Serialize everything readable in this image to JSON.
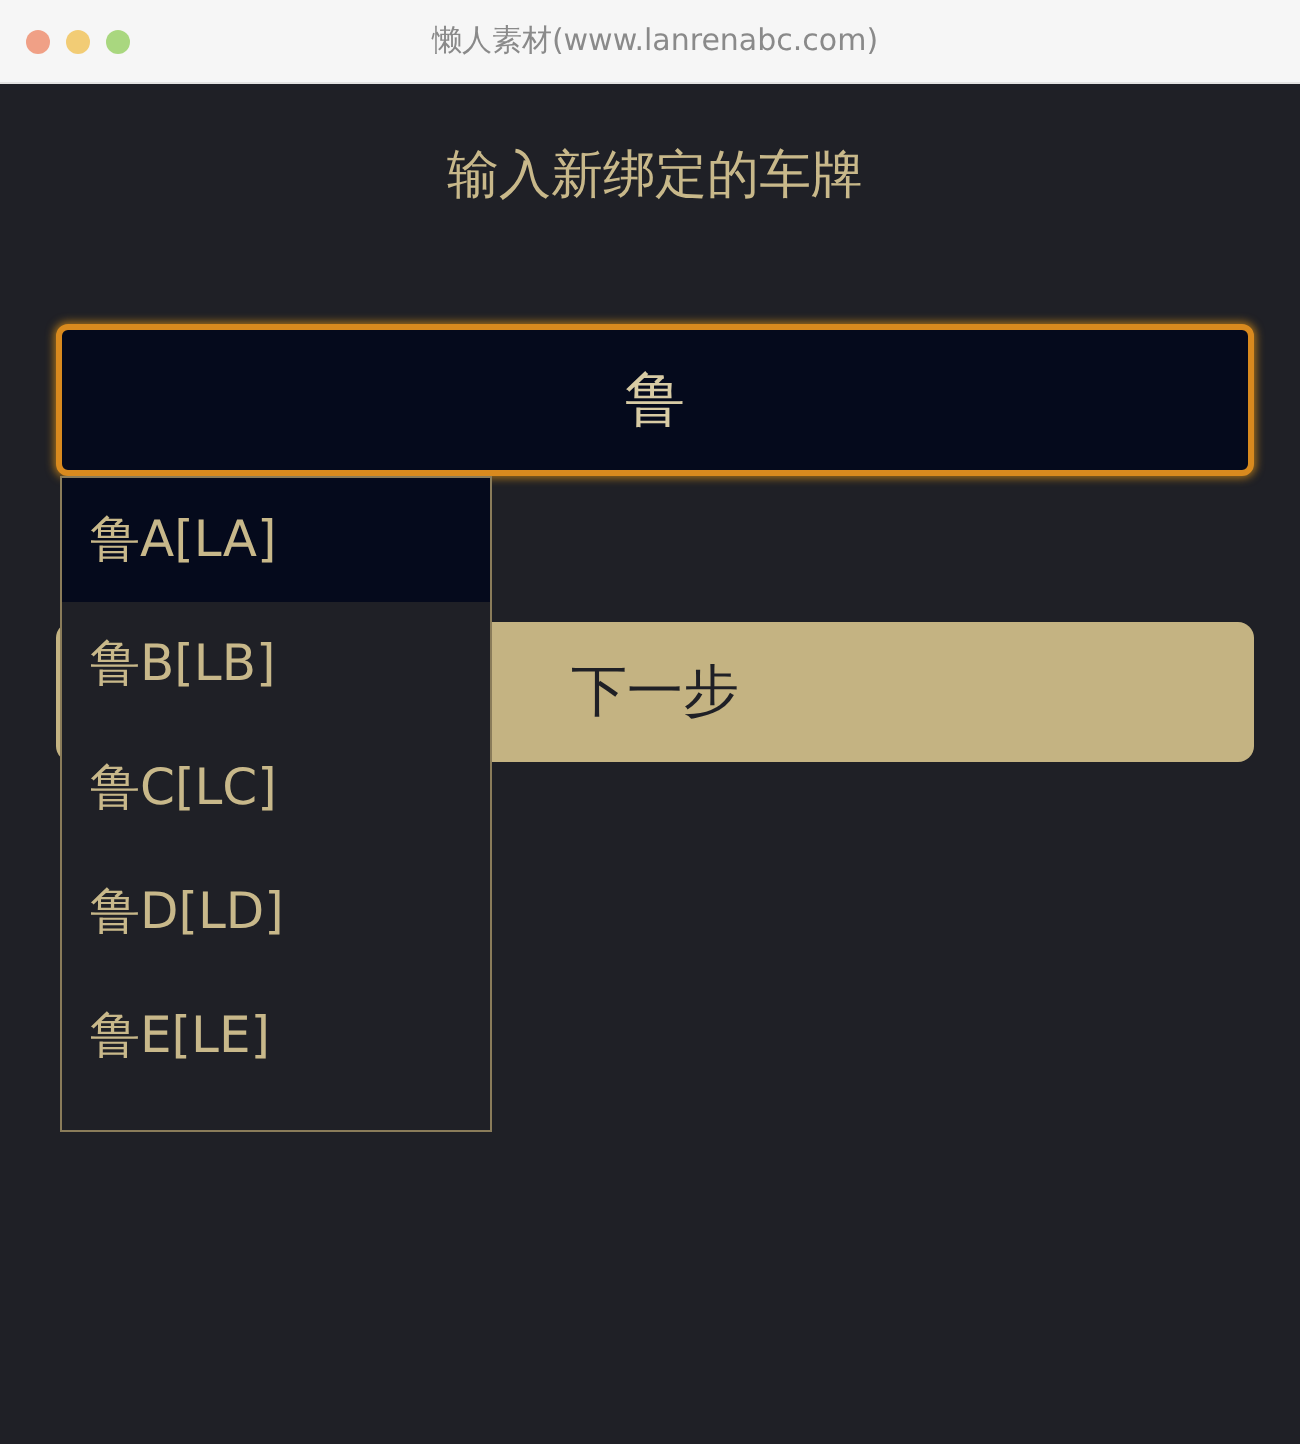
{
  "window": {
    "title": "懒人素材(www.lanrenabc.com)"
  },
  "heading": "输入新绑定的车牌",
  "plate_field": {
    "value": "鲁"
  },
  "suggestions": [
    {
      "label": "鲁A[LA]",
      "selected": true
    },
    {
      "label": "鲁B[LB]",
      "selected": false
    },
    {
      "label": "鲁C[LC]",
      "selected": false
    },
    {
      "label": "鲁D[LD]",
      "selected": false
    },
    {
      "label": "鲁E[LE]",
      "selected": false
    }
  ],
  "next_button": {
    "label": "下一步"
  }
}
